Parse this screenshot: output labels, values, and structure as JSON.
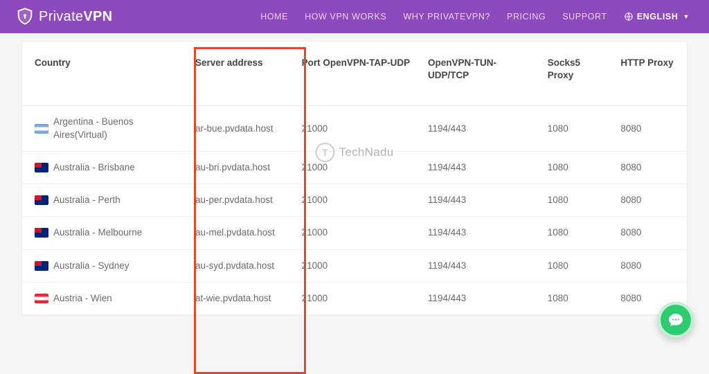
{
  "brand": {
    "name_light": "Private",
    "name_bold": "VPN"
  },
  "nav": {
    "items": [
      "HOME",
      "HOW VPN WORKS",
      "WHY PRIVATEVPN?",
      "PRICING",
      "SUPPORT"
    ],
    "language_label": "ENGLISH"
  },
  "table": {
    "headers": {
      "country": "Country",
      "server": "Server address",
      "tap": "Port OpenVPN-TAP-UDP",
      "tun": "OpenVPN-TUN-UDP/TCP",
      "socks": "Socks5 Proxy",
      "http": "HTTP Proxy"
    },
    "rows": [
      {
        "flag": "ar",
        "country": "Argentina - Buenos Aires(Virtual)",
        "server": "ar-bue.pvdata.host",
        "tap": "21000",
        "tun": "1194/443",
        "socks": "1080",
        "http": "8080"
      },
      {
        "flag": "au",
        "country": "Australia - Brisbane",
        "server": "au-bri.pvdata.host",
        "tap": "21000",
        "tun": "1194/443",
        "socks": "1080",
        "http": "8080"
      },
      {
        "flag": "au",
        "country": "Australia - Perth",
        "server": "au-per.pvdata.host",
        "tap": "21000",
        "tun": "1194/443",
        "socks": "1080",
        "http": "8080"
      },
      {
        "flag": "au",
        "country": "Australia - Melbourne",
        "server": "au-mel.pvdata.host",
        "tap": "21000",
        "tun": "1194/443",
        "socks": "1080",
        "http": "8080"
      },
      {
        "flag": "au",
        "country": "Australia - Sydney",
        "server": "au-syd.pvdata.host",
        "tap": "21000",
        "tun": "1194/443",
        "socks": "1080",
        "http": "8080"
      },
      {
        "flag": "at",
        "country": "Austria - Wien",
        "server": "at-wie.pvdata.host",
        "tap": "21000",
        "tun": "1194/443",
        "socks": "1080",
        "http": "8080"
      }
    ]
  },
  "watermark": "TechNadu",
  "colors": {
    "accent": "#8e49bd",
    "highlight": "#e04a2b",
    "chat": "#2ecc71"
  }
}
